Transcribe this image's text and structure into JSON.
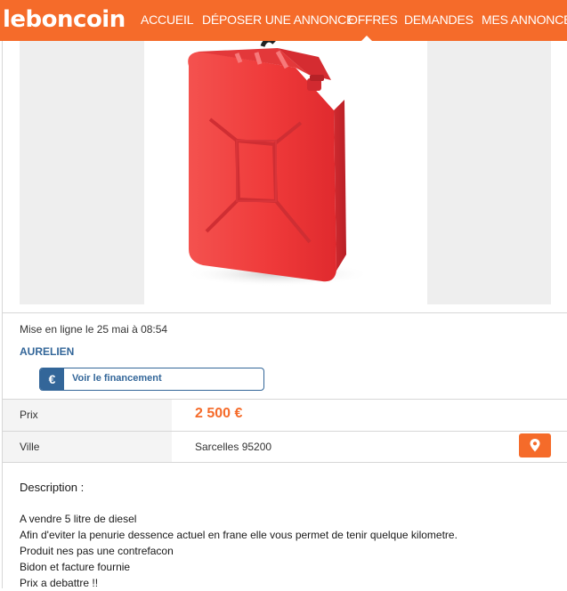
{
  "header": {
    "logo": "leboncoin",
    "nav": [
      {
        "label": "ACCUEIL"
      },
      {
        "label": "DÉPOSER UNE ANNONCE"
      },
      {
        "label": "OFFRES"
      },
      {
        "label": "DEMANDES"
      },
      {
        "label": "MES ANNONCES"
      }
    ],
    "active_nav": "OFFRES"
  },
  "listing": {
    "image_subject": "red-jerrycan",
    "posted": "Mise en ligne le 25 mai à 08:54",
    "seller": "AURELIEN",
    "finance": {
      "icon": "€",
      "label": "Voir le financement"
    },
    "details": [
      {
        "label": "Prix",
        "value": "2 500 €"
      },
      {
        "label": "Ville",
        "value": "Sarcelles 95200"
      }
    ],
    "description_title": "Description :",
    "description_lines": [
      "A vendre 5 litre de diesel",
      "Afin d'eviter la penurie dessence actuel en frane elle vous permet de tenir quelque kilometre.",
      "Produit nes pas une contrefacon",
      "Bidon et facture fournie",
      "Prix a debattre !!"
    ]
  },
  "colors": {
    "brand": "#f56b2a",
    "seller_link": "#4183d7",
    "finance": "#336699"
  }
}
